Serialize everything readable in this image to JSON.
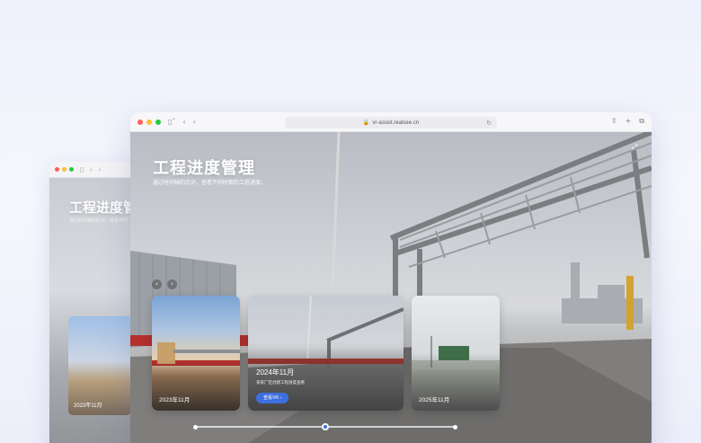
{
  "back_window": {
    "title": "工程进度管",
    "subtitle": "通过时间轴的比对，查看不同",
    "card_label": "2023年11月"
  },
  "front_window": {
    "url": "vr-assist.realsee.cn",
    "title": "工程进度管理",
    "subtitle": "通过时间轴的比对，查看不同时期的工程进度。",
    "cards": [
      {
        "label": "2023年11月"
      },
      {
        "label": "2024年11月",
        "description": "某某厂区创建工程进度查看",
        "button": "查看VR ›"
      },
      {
        "label": "2025年11月"
      }
    ],
    "nav": {
      "prev": "‹",
      "next": "›"
    },
    "timeline_active_index": 1
  },
  "colors": {
    "accent": "#3c6fe0",
    "traffic_red": "#ff5f57",
    "traffic_yellow": "#febc2e",
    "traffic_green": "#28c840"
  },
  "icons": [
    "sidebar-icon",
    "back-icon",
    "forward-icon",
    "lock-icon",
    "reload-icon",
    "share-icon",
    "new-tab-icon",
    "tabs-icon",
    "vr-share-icon"
  ]
}
